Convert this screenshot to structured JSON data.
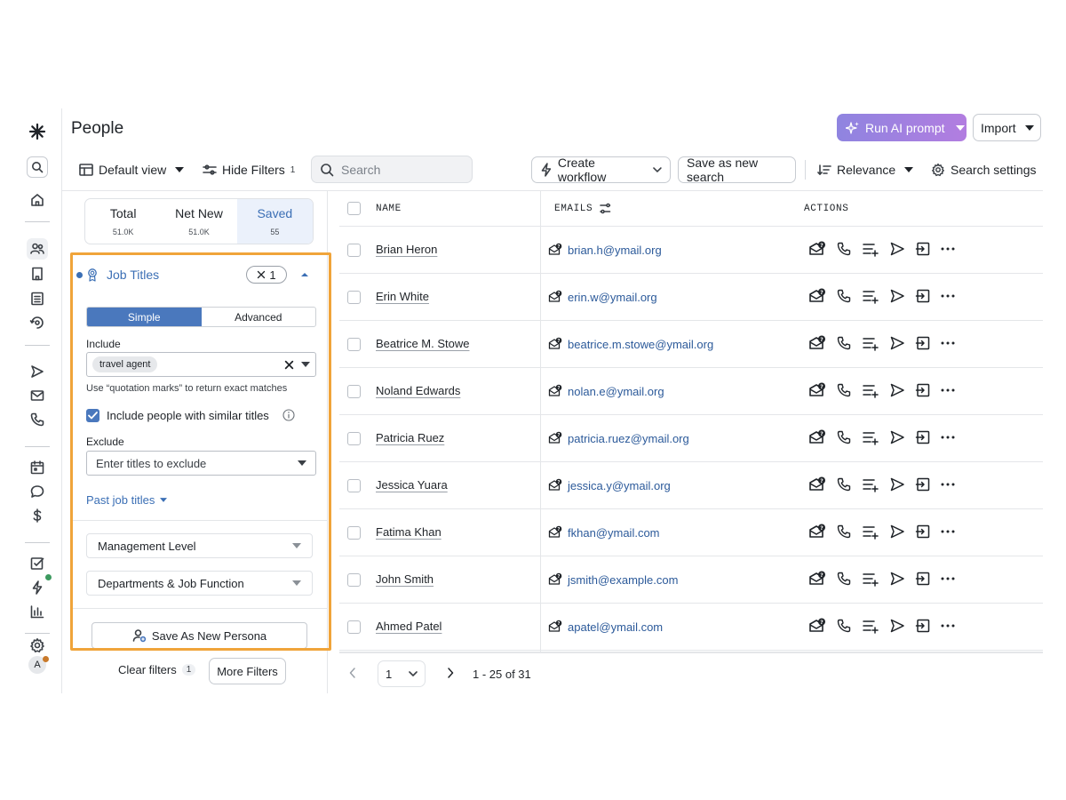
{
  "page": {
    "title": "People"
  },
  "header": {
    "run_ai_label": "Run AI prompt",
    "import_label": "Import"
  },
  "toolbar": {
    "default_view_label": "Default view",
    "hide_filters_label": "Hide Filters",
    "hide_filters_count": "1",
    "search_placeholder": "Search",
    "create_workflow_label": "Create workflow",
    "save_search_label": "Save as new search",
    "relevance_label": "Relevance",
    "search_settings_label": "Search settings"
  },
  "counts": [
    {
      "label": "Total",
      "value": "51.0K"
    },
    {
      "label": "Net New",
      "value": "51.0K"
    },
    {
      "label": "Saved",
      "value": "55"
    }
  ],
  "filters": {
    "job_titles": {
      "label": "Job Titles",
      "badge_count": "1",
      "tabs": [
        "Simple",
        "Advanced"
      ],
      "include_label": "Include",
      "include_value": "travel agent",
      "hint": "Use “quotation marks” to return exact matches",
      "similar_label": "Include people with similar titles",
      "exclude_label": "Exclude",
      "exclude_placeholder": "Enter titles to exclude",
      "past_job_titles_label": "Past job titles"
    },
    "management_level_label": "Management Level",
    "departments_label": "Departments & Job Function",
    "save_persona_label": "Save As New Persona",
    "clear_filters_label": "Clear filters",
    "clear_filters_count": "1",
    "more_filters_label": "More Filters"
  },
  "table": {
    "headers": {
      "name": "NAME",
      "emails": "EMAILS",
      "actions": "ACTIONS"
    },
    "rows": [
      {
        "name": "Brian Heron",
        "email": "brian.h@ymail.org"
      },
      {
        "name": "Erin White",
        "email": "erin.w@ymail.org"
      },
      {
        "name": "Beatrice M. Stowe",
        "email": "beatrice.m.stowe@ymail.org"
      },
      {
        "name": "Noland Edwards",
        "email": "nolan.e@ymail.org"
      },
      {
        "name": "Patricia Ruez",
        "email": "patricia.ruez@ymail.org"
      },
      {
        "name": "Jessica Yuara",
        "email": "jessica.y@ymail.org"
      },
      {
        "name": "Fatima Khan",
        "email": "fkhan@ymail.com"
      },
      {
        "name": "John Smith",
        "email": "jsmith@example.com"
      },
      {
        "name": "Ahmed Patel",
        "email": "apatel@ymail.com"
      }
    ]
  },
  "pagination": {
    "current_page": "1",
    "range": "1 - 25 of 31"
  },
  "user": {
    "avatar_initial": "A"
  },
  "colors": {
    "accent": "#3b6fb5",
    "highlight": "#f0a43a",
    "ai_gradient_start": "#8f84e0",
    "ai_gradient_end": "#b27de0"
  }
}
